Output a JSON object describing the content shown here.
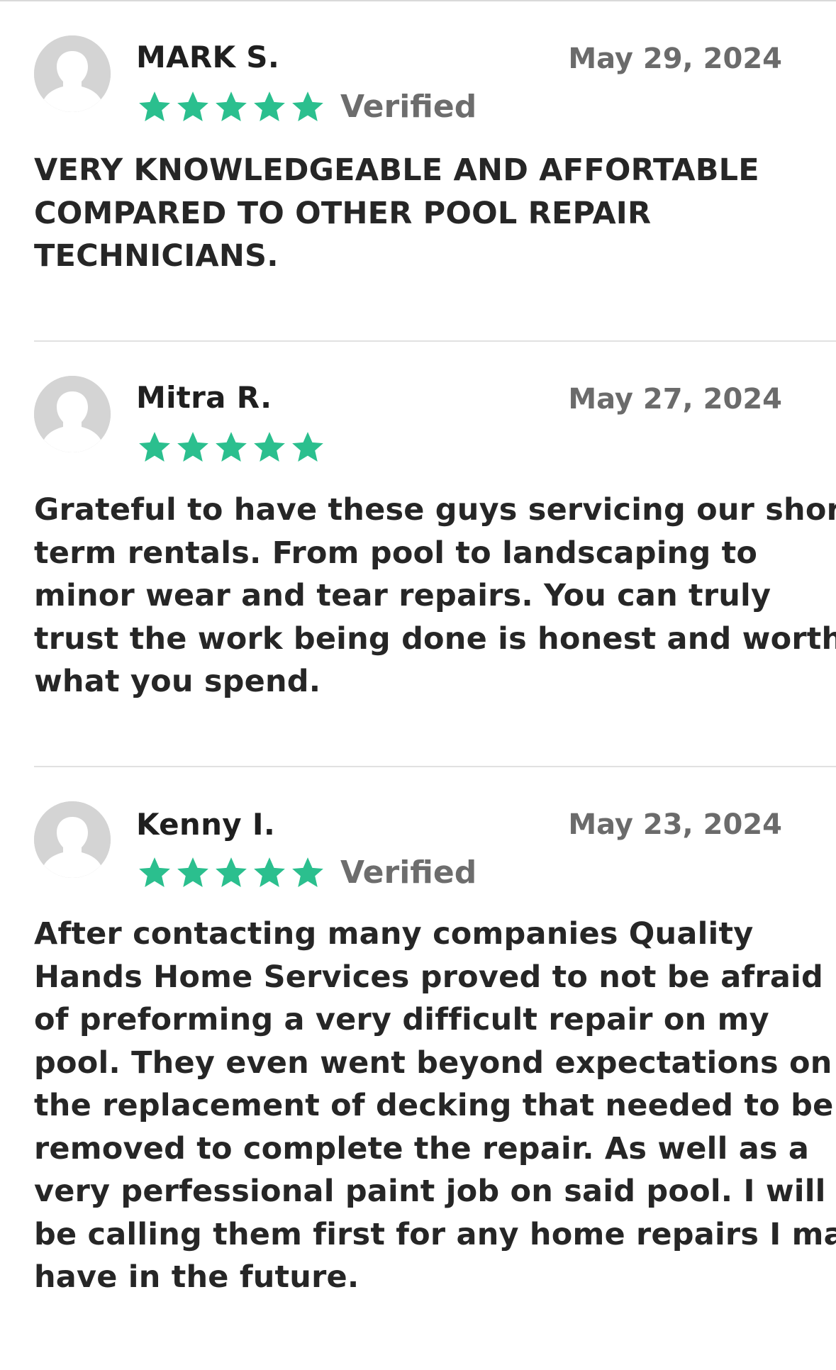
{
  "colors": {
    "star": "#2bbf8e",
    "avatar": "#d4d4d4",
    "divider": "#e1e1e1"
  },
  "reviews": [
    {
      "name": "MARK S.",
      "date": "May 29, 2024",
      "rating": 5,
      "verified_label": "Verified",
      "text_lines": [
        "VERY KNOWLEDGEABLE AND AFFORTABLE",
        "COMPARED TO OTHER POOL REPAIR",
        "TECHNICIANS."
      ]
    },
    {
      "name": "Mitra R.",
      "date": "May 27, 2024",
      "rating": 5,
      "verified_label": "",
      "text_lines": [
        "Grateful to have these guys servicing our short",
        "term rentals. From pool to landscaping to",
        "minor wear and tear repairs. You can truly",
        "trust the work being done is honest and worth",
        "what you spend."
      ]
    },
    {
      "name": "Kenny I.",
      "date": "May 23, 2024",
      "rating": 5,
      "verified_label": "Verified",
      "text_lines": [
        "After contacting many companies Quality",
        "Hands Home Services proved to not be afraid",
        "of preforming a very difficult repair on my",
        "pool. They even went beyond expectations on",
        "the replacement of decking that needed to be",
        "removed to complete the repair. As well as a",
        "very perfessional paint job on said pool. I will",
        "be calling them first for any home repairs I may",
        "have in the future."
      ]
    }
  ]
}
